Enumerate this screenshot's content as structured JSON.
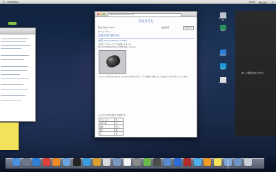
{
  "menubar": {
    "app_name": "Omnifocus",
    "right_clock": "12:07",
    "user": "みんなと",
    "search_icon": "search-icon"
  },
  "browser": {
    "url": "hakodate.blog119.fc2.com",
    "blog_title": "ひるささと",
    "meta_left": "晴天 気温(2012.8)",
    "meta_right": "最新情報",
    "meta_button": "ログイン",
    "subline": "PR ウェブサイト",
    "date": "2012/07/19 (木)",
    "post_title": "[対応] Microsoft Mouse 3000",
    "paragraph_lines": [
      "先日ウェブサイトでマウスを購入しました。",
      "Windows Mobile Mouse 3000 を使っています。"
    ],
    "paragraph2": "小さいとか言われる方もいらっしゃるかと思いますが、マウスを握った際にちょうど良いサイズで気に入っています。",
    "paragraph3": "このマウスは持ち運びにも便利です。",
    "table_rows": [
      [
        "ワイヤレス",
        "有"
      ],
      [
        "ボタン数",
        "3"
      ],
      [
        "電池",
        "単三"
      ],
      [
        "重さ",
        "軽"
      ],
      [
        "色",
        "黒"
      ]
    ]
  },
  "notification": {
    "text": "新しい通知はありません"
  },
  "desktop_icons": [
    {
      "label": "Macintosh HD",
      "color": "#b9c3cf"
    },
    {
      "label": "Apps",
      "color": "#2a8f5f"
    },
    {
      "label": "Dropbox",
      "color": "#2d7fd6"
    },
    {
      "label": "Skype",
      "color": "#1e9ad6"
    },
    {
      "label": "Screenshot",
      "color": "#e0e0e0"
    }
  ],
  "dock_icons": [
    {
      "name": "finder-icon",
      "color": "#4a90e2"
    },
    {
      "name": "launchpad-icon",
      "color": "#6b7b8c"
    },
    {
      "name": "safari-icon",
      "color": "#2f80d8"
    },
    {
      "name": "chrome-icon",
      "color": "#e0403a"
    },
    {
      "name": "firefox-icon",
      "color": "#f08a24"
    },
    {
      "name": "mail-icon",
      "color": "#6aa3dd"
    },
    {
      "name": "terminal-icon",
      "color": "#222222"
    },
    {
      "name": "itunes-icon",
      "color": "#3aa0e0"
    },
    {
      "name": "photos-icon",
      "color": "#d8a030"
    },
    {
      "name": "ical-icon",
      "color": "#dcdcdc"
    },
    {
      "name": "preview-icon",
      "color": "#7a99c0"
    },
    {
      "name": "textedit-icon",
      "color": "#f3f3f3"
    },
    {
      "name": "settings-icon",
      "color": "#8b8b8b"
    },
    {
      "name": "evernote-icon",
      "color": "#6bb84b"
    },
    {
      "name": "dictionary-icon",
      "color": "#4d4d4d"
    },
    {
      "name": "xcode-icon",
      "color": "#5a8ad0"
    },
    {
      "name": "itunes-store-icon",
      "color": "#2b6ed8"
    },
    {
      "name": "adobe-icon",
      "color": "#b22a2a"
    },
    {
      "name": "twitter-icon",
      "color": "#4db0e8"
    },
    {
      "name": "vlc-icon",
      "color": "#f29a23"
    },
    {
      "name": "stickies-icon",
      "color": "#f4e35a"
    },
    {
      "name": "folder-icon",
      "color": "#7fa6d8"
    },
    {
      "name": "downloads-icon",
      "color": "#6f95c8"
    },
    {
      "name": "trash-icon",
      "color": "#c9cfd6"
    }
  ]
}
